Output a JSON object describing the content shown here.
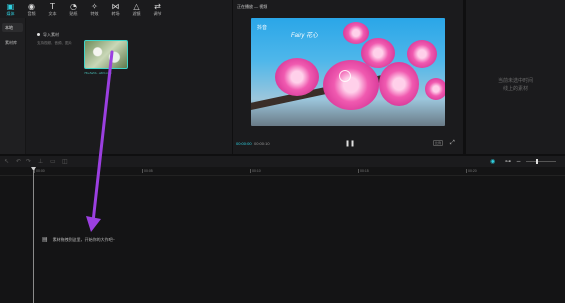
{
  "toolbar": {
    "items": [
      {
        "label": "媒体",
        "icon": "media-icon"
      },
      {
        "label": "音频",
        "icon": "audio-icon"
      },
      {
        "label": "文本",
        "icon": "text-icon"
      },
      {
        "label": "贴纸",
        "icon": "sticker-icon"
      },
      {
        "label": "特效",
        "icon": "effects-icon"
      },
      {
        "label": "转场",
        "icon": "transition-icon"
      },
      {
        "label": "滤镜",
        "icon": "filter-icon"
      },
      {
        "label": "调节",
        "icon": "adjust-icon"
      }
    ]
  },
  "media": {
    "sidebar": [
      {
        "label": "本地"
      },
      {
        "label": "素材库"
      }
    ],
    "import_label": "导入素材",
    "import_sub": "支持视频、音频、图片",
    "thumb_caption": "7fbe5a5b...a6f3.mp4"
  },
  "player": {
    "title": "正在播放 — 视频",
    "watermark": "抖音",
    "watermark_script": "Fairy 花心",
    "time_current": "00:00:00",
    "time_total": "00:00:10",
    "ratio_label": "比例"
  },
  "properties": {
    "empty_text_1": "当前未选中时间",
    "empty_text_2": "线上的素材"
  },
  "timeline": {
    "ticks": [
      "00:00",
      "00:05",
      "00:10",
      "00:15",
      "00:20"
    ],
    "drop_hint": "素材拖拽到这里，开始你的大作吧~"
  },
  "colors": {
    "accent": "#2fd0e0",
    "arrow": "#9b3fe0"
  }
}
